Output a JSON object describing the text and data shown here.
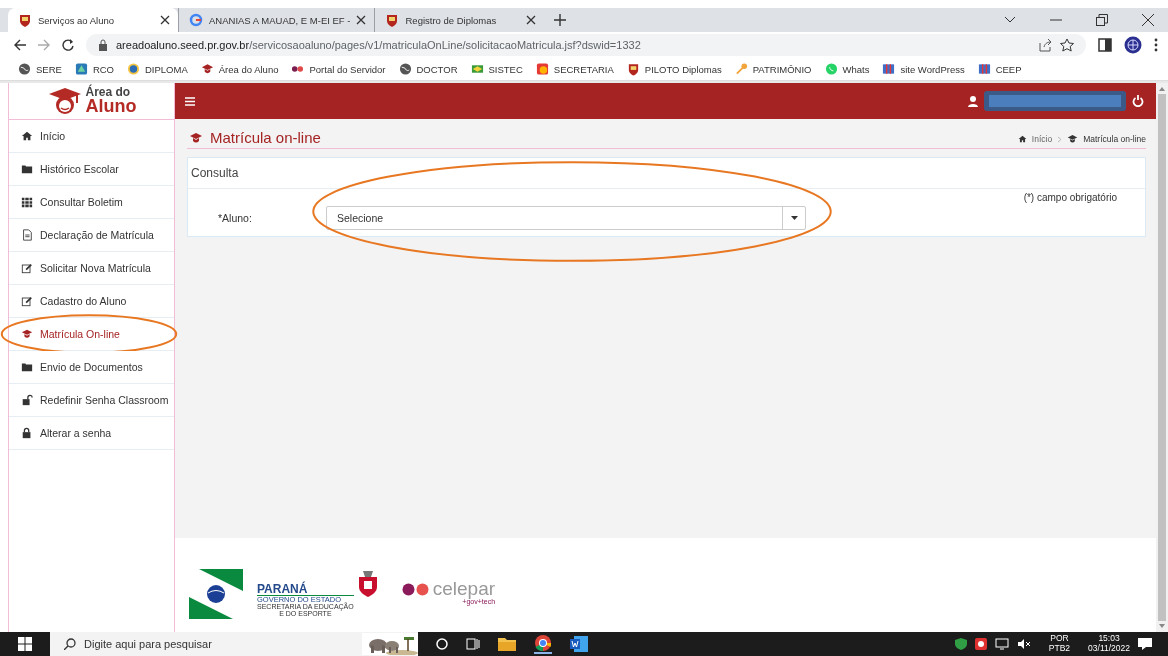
{
  "browser": {
    "tabs": [
      {
        "title": "Serviços ao Aluno",
        "selected": true
      },
      {
        "title": "ANANIAS A MAUAD, E M-EI EF -",
        "selected": false
      },
      {
        "title": "Registro de Diplomas",
        "selected": false
      }
    ],
    "url_host": "areadoaluno.seed.pr.gov.br",
    "url_path": "/servicosaoaluno/pages/v1/matriculaOnLine/solicitacaoMatricula.jsf?dswid=1332",
    "bookmarks": [
      "SERE",
      "RCO",
      "DIPLOMA",
      "Área do Aluno",
      "Portal do Servidor",
      "DOCTOR",
      "SISTEC",
      "SECRETARIA",
      "PILOTO Diplomas",
      "PATRIMÔNIO",
      "Whats",
      "site WordPress",
      "CEEP"
    ]
  },
  "logo": {
    "line_1": "Área do",
    "line_2": "Aluno"
  },
  "header": {
    "user_redacted": true
  },
  "sidebar": {
    "items": [
      {
        "label": "Início",
        "selected": false,
        "circled": false
      },
      {
        "label": "Histórico Escolar",
        "selected": false,
        "circled": false
      },
      {
        "label": "Consultar Boletim",
        "selected": false,
        "circled": false
      },
      {
        "label": "Declaração de Matrícula",
        "selected": false,
        "circled": false
      },
      {
        "label": "Solicitar Nova Matrícula",
        "selected": false,
        "circled": false
      },
      {
        "label": "Cadastro do Aluno",
        "selected": false,
        "circled": false
      },
      {
        "label": "Matrícula On-line",
        "selected": true,
        "circled": true
      },
      {
        "label": "Envio de Documentos",
        "selected": false,
        "circled": false
      },
      {
        "label": "Redefinir Senha Classroom",
        "selected": false,
        "circled": false
      },
      {
        "label": "Alterar a senha",
        "selected": false,
        "circled": false
      }
    ]
  },
  "page": {
    "title": "Matrícula on-line",
    "breadcrumb": [
      "Início",
      "Matrícula on-line"
    ],
    "panel": {
      "title": "Consulta",
      "required_note": "(*) campo obrigatório",
      "field": {
        "label": "*Aluno:",
        "value": "Selecione",
        "circled": true
      }
    }
  },
  "footer": {
    "parana": {
      "name": "PARANÁ",
      "line_1": "GOVERNO DO ESTADO",
      "line_2": "SECRETARIA DA EDUCAÇÃO",
      "line_3": "E DO ESPORTE"
    },
    "celepar": {
      "name": "celepar",
      "tagline": "+gov+tech"
    }
  },
  "taskbar": {
    "search_placeholder": "Digite aqui para pesquisar",
    "language": "POR",
    "layout": "PTB2",
    "time": "15:03",
    "date": "03/11/2022"
  }
}
